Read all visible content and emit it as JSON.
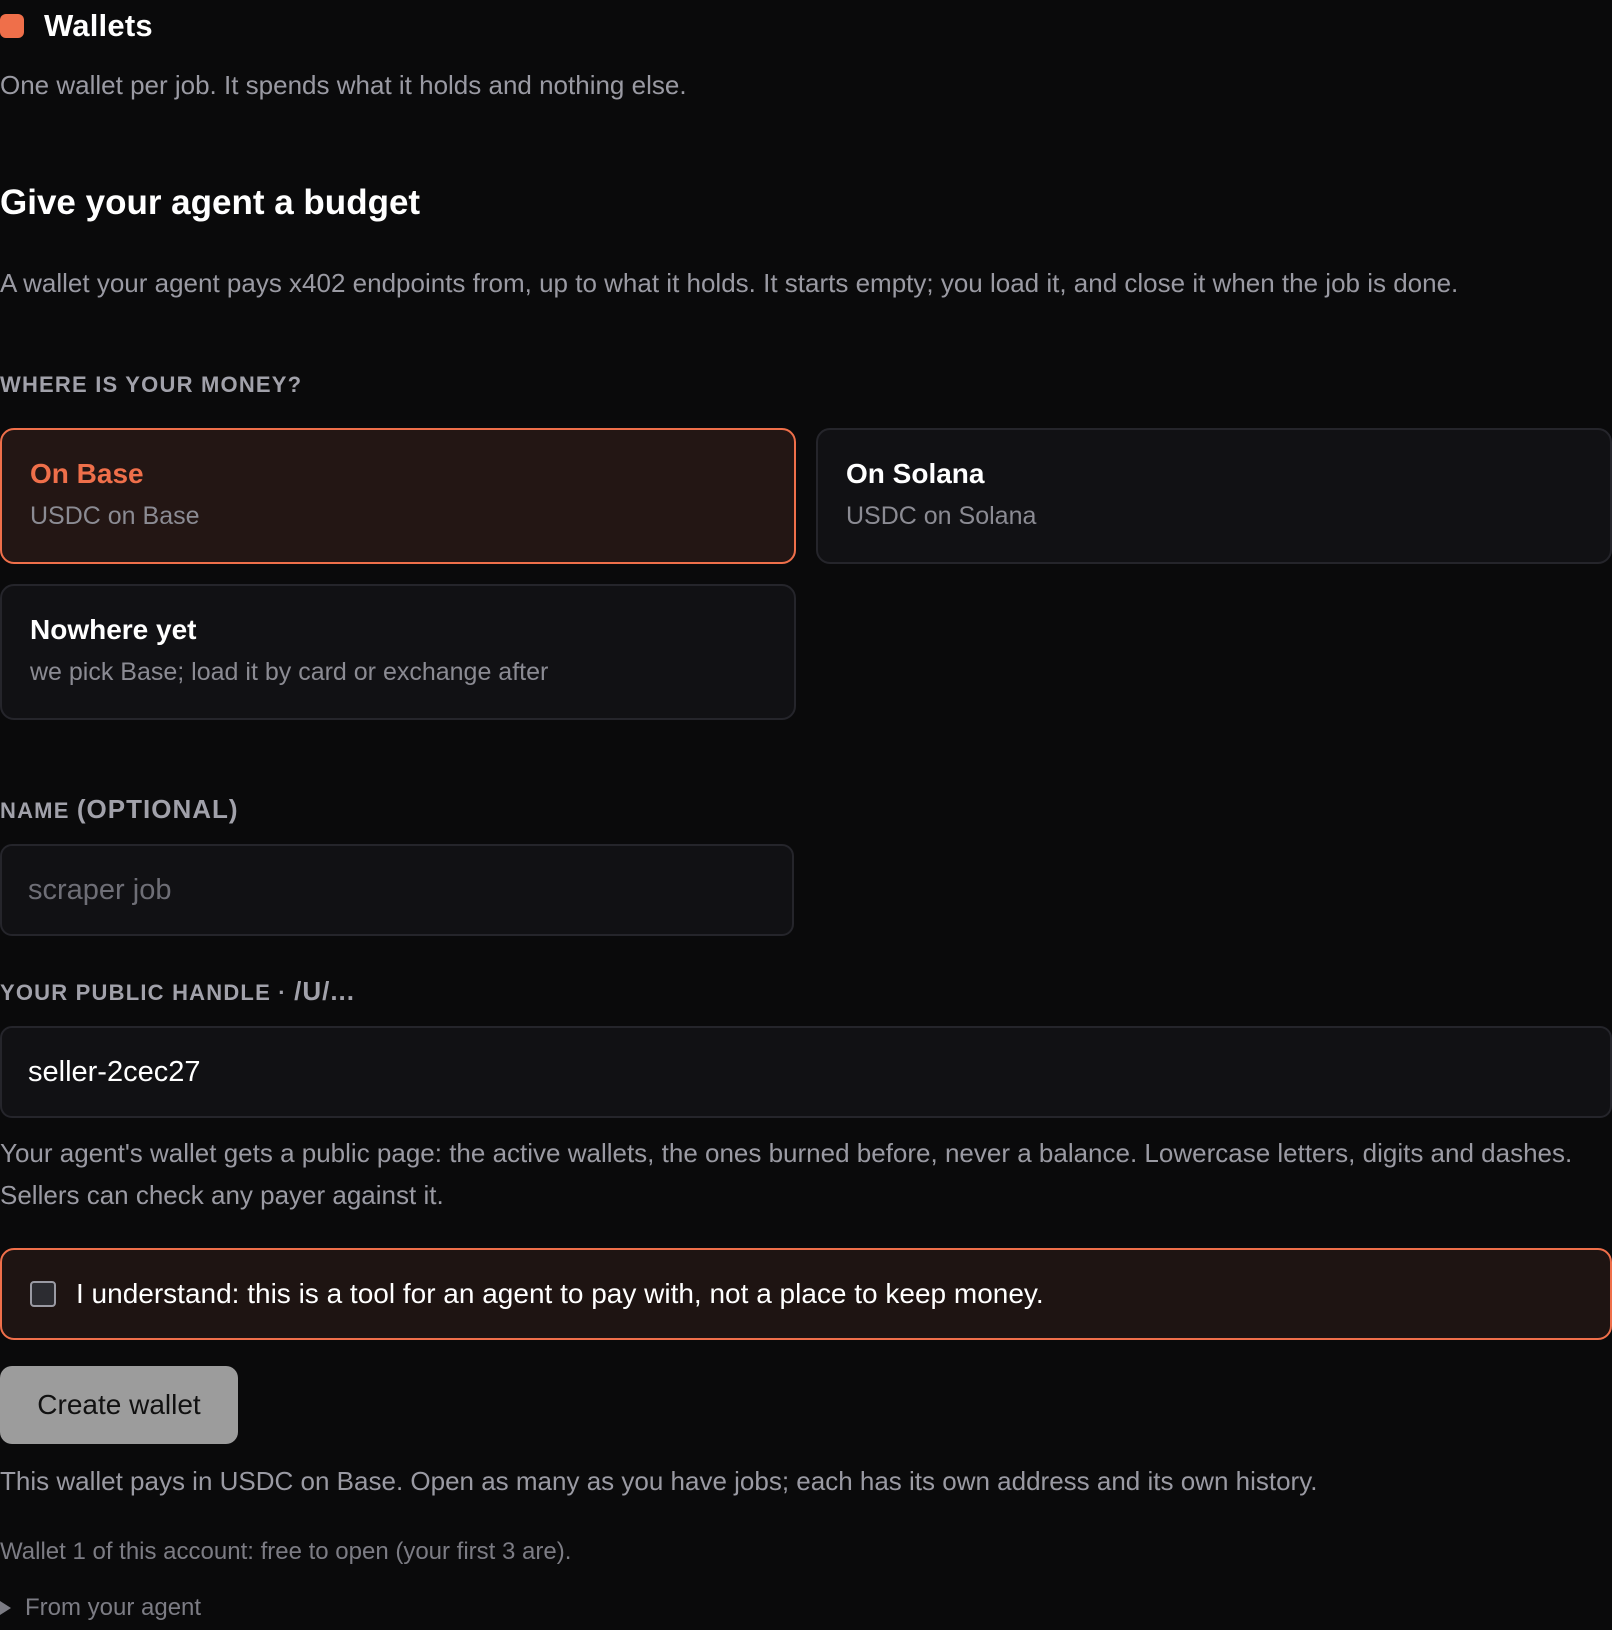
{
  "header": {
    "title": "Wallets",
    "tagline": "One wallet per job. It spends what it holds and nothing else.",
    "accent_color": "#ef6f4a"
  },
  "section": {
    "title": "Give your agent a budget",
    "description": "A wallet your agent pays x402 endpoints from, up to what it holds. It starts empty; you load it, and close it when the job is done."
  },
  "money_location": {
    "label": "WHERE IS YOUR MONEY?",
    "selected": "On Base",
    "options": [
      {
        "title": "On Base",
        "subtitle": "USDC on Base"
      },
      {
        "title": "On Solana",
        "subtitle": "USDC on Solana"
      },
      {
        "title": "Nowhere yet",
        "subtitle": "we pick Base; load it by card or exchange after"
      }
    ]
  },
  "name_field": {
    "label_main": "NAME ",
    "label_suffix": "(OPTIONAL)",
    "placeholder": "scraper job",
    "value": ""
  },
  "handle_field": {
    "label_main": "YOUR PUBLIC HANDLE · ",
    "label_suffix": "/U/...",
    "value": "seller-2cec27",
    "help": "Your agent's wallet gets a public page: the active wallets, the ones burned before, never a balance. Lowercase letters, digits and dashes. Sellers can check any payer against it."
  },
  "acknowledgement": {
    "checked": false,
    "text": "I understand: this is a tool for an agent to pay with, not a place to keep money."
  },
  "actions": {
    "create_label": "Create wallet"
  },
  "footer": {
    "info": "This wallet pays in USDC on Base. Open as many as you have jobs; each has its own address and its own history.",
    "count_note": "Wallet 1 of this account: free to open (your first 3 are).",
    "disclosure": "From your agent"
  }
}
